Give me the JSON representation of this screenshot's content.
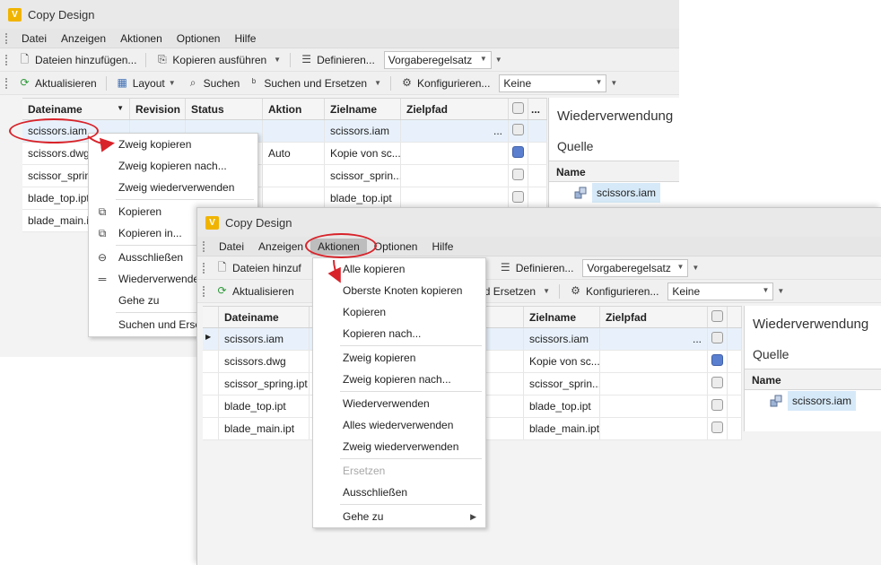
{
  "app": {
    "title": "Copy Design",
    "logo_letter": "V"
  },
  "menu": {
    "items": [
      "Datei",
      "Anzeigen",
      "Aktionen",
      "Optionen",
      "Hilfe"
    ]
  },
  "toolbar1": {
    "add_files": "Dateien hinzufügen...",
    "add_files_short": "Dateien hinzuf",
    "run_copy": "Kopieren ausführen",
    "define": "Definieren...",
    "ruleset_value": "Vorgaberegelsatz"
  },
  "toolbar2": {
    "refresh": "Aktualisieren",
    "layout": "Layout",
    "search": "Suchen",
    "search_replace": "Suchen und Ersetzen",
    "search_replace_partial": "en und Ersetzen",
    "configure": "Konfigurieren...",
    "none_value": "Keine"
  },
  "grid": {
    "headers": {
      "filename": "Dateiname",
      "revision": "Revision",
      "status": "Status",
      "action": "Aktion",
      "action_partial": "on",
      "targetname": "Zielname",
      "targetpath": "Zielpfad",
      "more": "..."
    },
    "rows1": [
      {
        "file": "scissors.iam",
        "action": "",
        "target": "scissors.iam",
        "path": "...",
        "blue": false
      },
      {
        "file": "scissors.dwg",
        "action": "Auto",
        "target": "Kopie von sc...",
        "path": "",
        "blue": true
      },
      {
        "file": "scissor_spring",
        "action": "",
        "target": "scissor_sprin...",
        "path": "",
        "blue": false
      },
      {
        "file": "blade_top.ipt",
        "action": "",
        "target": "blade_top.ipt",
        "path": "",
        "blue": false
      },
      {
        "file": "blade_main.ip",
        "action": "",
        "target": "",
        "path": "",
        "blue": false
      }
    ],
    "rows2": [
      {
        "file": "scissors.iam",
        "target": "scissors.iam",
        "path": "...",
        "blue": false
      },
      {
        "file": "scissors.dwg",
        "target": "Kopie von sc...",
        "path": "",
        "blue": true
      },
      {
        "file": "scissor_spring.ipt",
        "target": "scissor_sprin...",
        "path": "",
        "blue": false
      },
      {
        "file": "blade_top.ipt",
        "target": "blade_top.ipt",
        "path": "",
        "blue": false
      },
      {
        "file": "blade_main.ipt",
        "target": "blade_main.ipt",
        "path": "",
        "blue": false
      }
    ]
  },
  "right_panel": {
    "title": "Wiederverwendung",
    "source": "Quelle",
    "name_header": "Name",
    "item": "scissors.iam"
  },
  "context_menu": {
    "copy_branch": "Zweig kopieren",
    "copy_branch_to": "Zweig kopieren nach...",
    "reuse_branch": "Zweig wiederverwenden",
    "copy": "Kopieren",
    "copy_in": "Kopieren in...",
    "exclude": "Ausschließen",
    "reuse_partial": "Wiederverwende",
    "goto": "Gehe zu",
    "search_replace_partial": "Suchen und Erse"
  },
  "actions_menu": {
    "copy_all": "Alle kopieren",
    "copy_top_nodes": "Oberste Knoten kopieren",
    "copy": "Kopieren",
    "copy_to": "Kopieren nach...",
    "copy_branch": "Zweig kopieren",
    "copy_branch_to": "Zweig kopieren nach...",
    "reuse": "Wiederverwenden",
    "reuse_all": "Alles wiederverwenden",
    "reuse_branch": "Zweig wiederverwenden",
    "replace": "Ersetzen",
    "exclude": "Ausschließen",
    "goto": "Gehe zu"
  },
  "colors": {
    "annotation": "#d8232a",
    "selection": "#e8f1fb",
    "checkbox_blue": "#5b7fcf"
  }
}
